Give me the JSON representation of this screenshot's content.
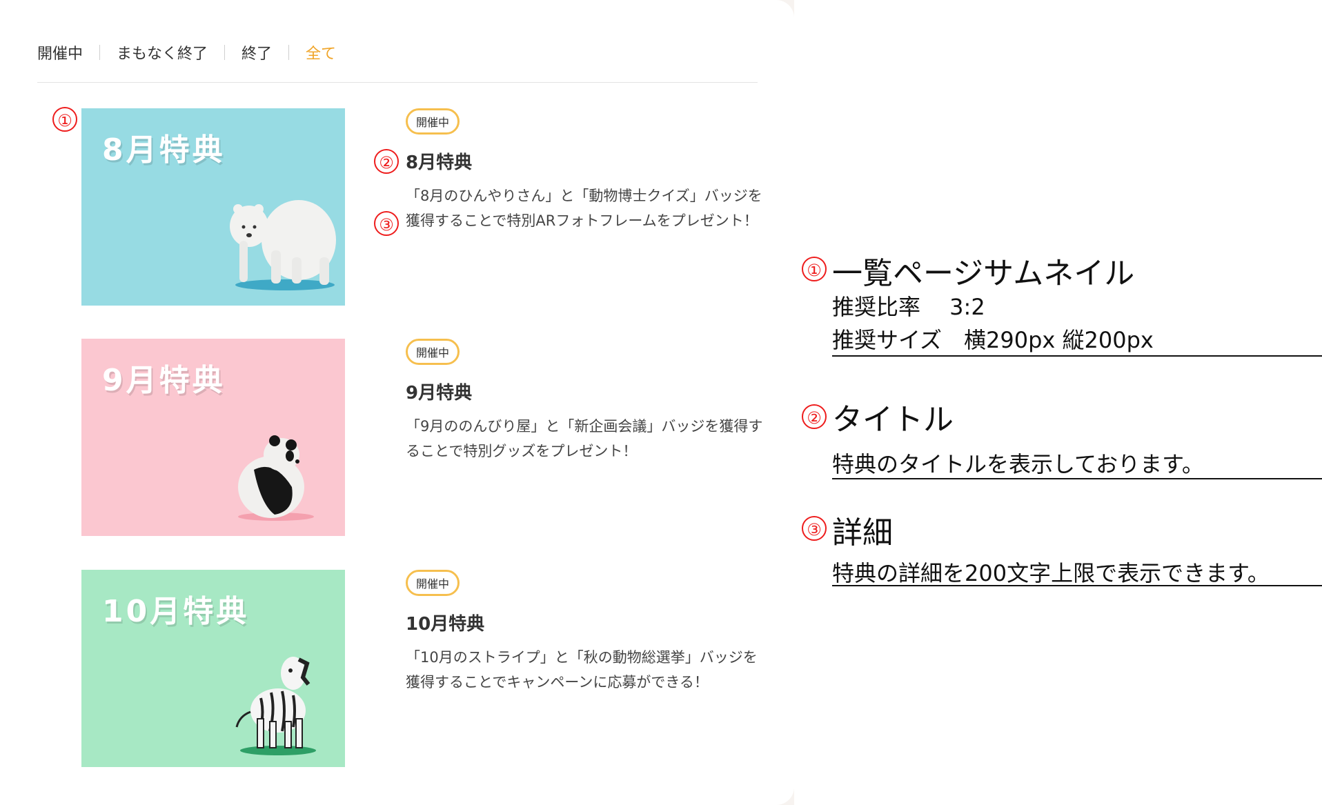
{
  "tabs": [
    "開催中",
    "まもなく終了",
    "終了",
    "全て"
  ],
  "items": [
    {
      "thumb_title": "8月特典",
      "thumb_bg": "#97dbe3",
      "badge": "開催中",
      "title": "8月特典",
      "desc": "「8月のひんやりさん」と「動物博士クイズ」バッジを獲得することで特別ARフォトフレームをプレゼント！",
      "animal": "polar-bear"
    },
    {
      "thumb_title": "9月特典",
      "thumb_bg": "#fbc7d0",
      "badge": "開催中",
      "title": "9月特典",
      "desc": "「9月ののんびり屋」と「新企画会議」バッジを獲得することで特別グッズをプレゼント！",
      "animal": "panda"
    },
    {
      "thumb_title": "10月特典",
      "thumb_bg": "#a7e8c4",
      "badge": "開催中",
      "title": "10月特典",
      "desc": "「10月のストライプ」と「秋の動物総選挙」バッジを獲得することでキャンペーンに応募ができる！",
      "animal": "zebra"
    }
  ],
  "markers": {
    "one": "①",
    "two": "②",
    "three": "③"
  },
  "annotations": {
    "a1": {
      "marker": "①",
      "heading": "一覧ページサムネイル",
      "line1": "推奨比率　 3:2",
      "line2": "推奨サイズ　横290px 縦200px"
    },
    "a2": {
      "marker": "②",
      "heading": "タイトル",
      "line1": "特典のタイトルを表示しております。"
    },
    "a3": {
      "marker": "③",
      "heading": "詳細",
      "line1": "特典の詳細を200文字上限で表示できます。"
    }
  },
  "colors": {
    "accent": "#f0a427",
    "badge_border": "#f6bf4e",
    "marker_red": "#ee1c1c"
  }
}
